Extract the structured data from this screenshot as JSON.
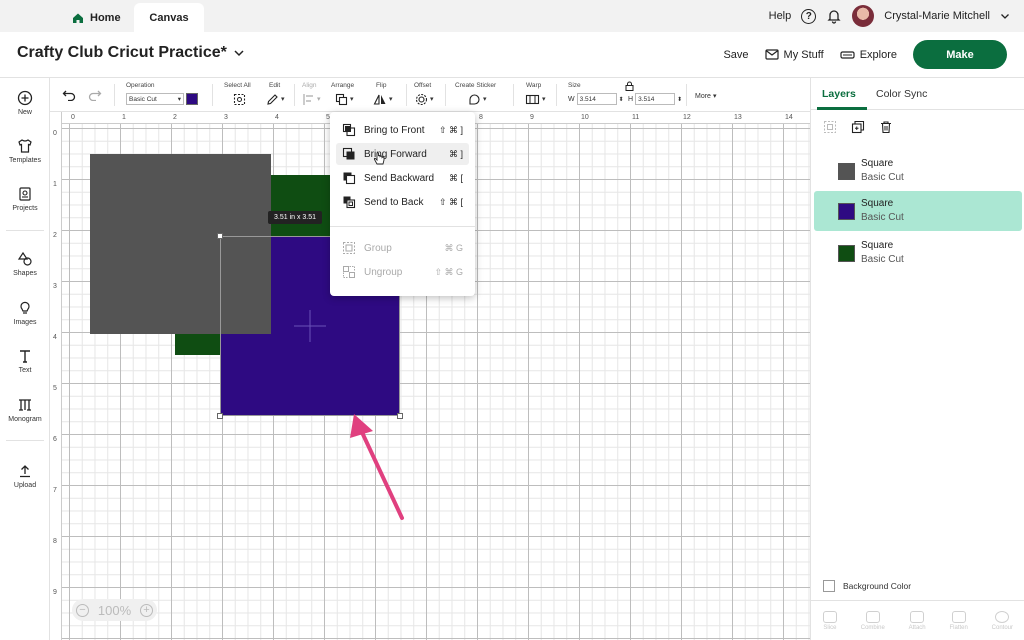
{
  "tabs": {
    "home": "Home",
    "canvas": "Canvas"
  },
  "header": {
    "help": "Help",
    "user_name": "Crystal-Marie Mitchell"
  },
  "title_bar": {
    "project_title": "Crafty Club Cricut Practice*",
    "save": "Save",
    "my_stuff": "My Stuff",
    "explore": "Explore",
    "make": "Make"
  },
  "sidebar": {
    "items": [
      {
        "label": "New",
        "icon": "plus-circle-icon"
      },
      {
        "label": "Templates",
        "icon": "shirt-icon"
      },
      {
        "label": "Projects",
        "icon": "projects-icon"
      },
      {
        "label": "Shapes",
        "icon": "shapes-icon"
      },
      {
        "label": "Images",
        "icon": "lightbulb-icon"
      },
      {
        "label": "Text",
        "icon": "text-icon"
      },
      {
        "label": "Monogram",
        "icon": "monogram-icon"
      },
      {
        "label": "Upload",
        "icon": "upload-icon"
      }
    ]
  },
  "toolbar": {
    "operation_label": "Operation",
    "operation_value": "Basic Cut",
    "operation_color": "#2e0a82",
    "select_all": "Select All",
    "edit": "Edit",
    "align": "Align",
    "arrange": "Arrange",
    "flip": "Flip",
    "offset": "Offset",
    "create_sticker": "Create Sticker",
    "warp": "Warp",
    "size": "Size",
    "w_label": "W",
    "w_value": "3.514",
    "h_label": "H",
    "h_value": "3.514",
    "more": "More"
  },
  "rulers": {
    "top": [
      "0",
      "1",
      "2",
      "3",
      "4",
      "5",
      "6",
      "7",
      "8",
      "9",
      "10",
      "11",
      "12",
      "13",
      "14"
    ],
    "left": [
      "0",
      "1",
      "2",
      "3",
      "4",
      "5",
      "6",
      "7",
      "8",
      "9"
    ]
  },
  "canvas": {
    "size_tooltip": "3.51  in x 3.51",
    "zoom": "100%",
    "shapes": [
      {
        "name": "gray-square",
        "color": "#545454"
      },
      {
        "name": "green-square",
        "color": "#0f4d12"
      },
      {
        "name": "purple-square",
        "color": "#2e0a82"
      }
    ]
  },
  "arrange_menu": {
    "items": [
      {
        "label": "Bring to Front",
        "shortcut": "⇧ ⌘ ]",
        "enabled": true
      },
      {
        "label": "Bring Forward",
        "shortcut": "⌘ ]",
        "enabled": true,
        "hover": true
      },
      {
        "label": "Send Backward",
        "shortcut": "⌘ [",
        "enabled": true
      },
      {
        "label": "Send to Back",
        "shortcut": "⇧ ⌘ [",
        "enabled": true
      },
      {
        "label": "Group",
        "shortcut": "⌘ G",
        "enabled": false
      },
      {
        "label": "Ungroup",
        "shortcut": "⇧ ⌘ G",
        "enabled": false
      }
    ]
  },
  "layers_panel": {
    "tabs": [
      "Layers",
      "Color Sync"
    ],
    "active_tab": "Layers",
    "layers": [
      {
        "name": "Square",
        "operation": "Basic Cut",
        "color": "#545454",
        "selected": false
      },
      {
        "name": "Square",
        "operation": "Basic Cut",
        "color": "#2e0a82",
        "selected": true
      },
      {
        "name": "Square",
        "operation": "Basic Cut",
        "color": "#0f4d12",
        "selected": false
      }
    ],
    "background_color": "Background Color",
    "bottom_actions": [
      "Slice",
      "Combine",
      "Attach",
      "Flatten",
      "Contour"
    ]
  },
  "colors": {
    "brand_green": "#0b6e3f",
    "selection_highlight": "#abe7d3",
    "annotation_arrow": "#e0407f"
  }
}
